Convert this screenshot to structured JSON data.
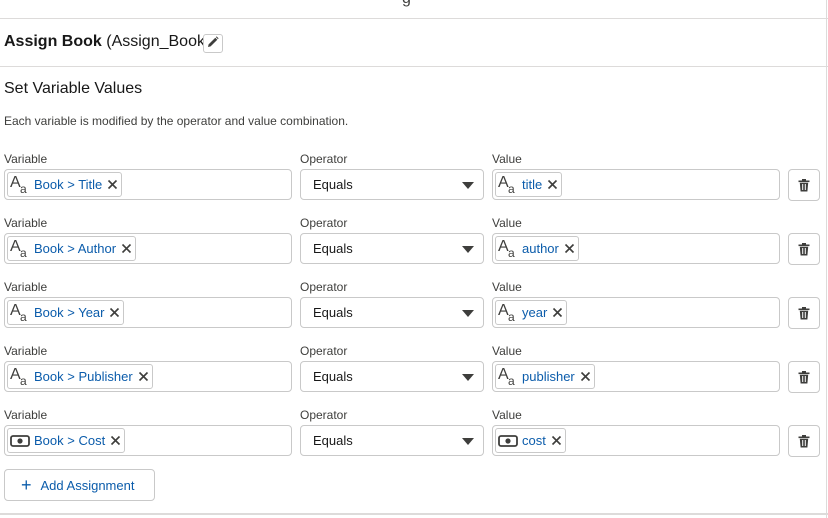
{
  "top_fragment": "g",
  "header": {
    "title_name": "Assign Book",
    "title_api": "(Assign_Book)",
    "edit_icon": "pencil-icon"
  },
  "section": {
    "title": "Set Variable Values",
    "description": "Each variable is modified by the operator and value combination."
  },
  "labels": {
    "variable": "Variable",
    "operator": "Operator",
    "value": "Value"
  },
  "rows": [
    {
      "variable": "Book > Title",
      "variable_icon": "text-icon",
      "operator": "Equals",
      "value": "title",
      "value_icon": "text-icon"
    },
    {
      "variable": "Book > Author",
      "variable_icon": "text-icon",
      "operator": "Equals",
      "value": "author",
      "value_icon": "text-icon"
    },
    {
      "variable": "Book > Year",
      "variable_icon": "text-icon",
      "operator": "Equals",
      "value": "year",
      "value_icon": "text-icon"
    },
    {
      "variable": "Book > Publisher",
      "variable_icon": "text-icon",
      "operator": "Equals",
      "value": "publisher",
      "value_icon": "text-icon"
    },
    {
      "variable": "Book > Cost",
      "variable_icon": "currency-icon",
      "operator": "Equals",
      "value": "cost",
      "value_icon": "currency-icon"
    }
  ],
  "add_button": {
    "label": "Add Assignment",
    "icon": "plus-icon"
  },
  "colors": {
    "link": "#0b5cab",
    "border": "#c9c9c9",
    "divider": "#dddbda"
  }
}
